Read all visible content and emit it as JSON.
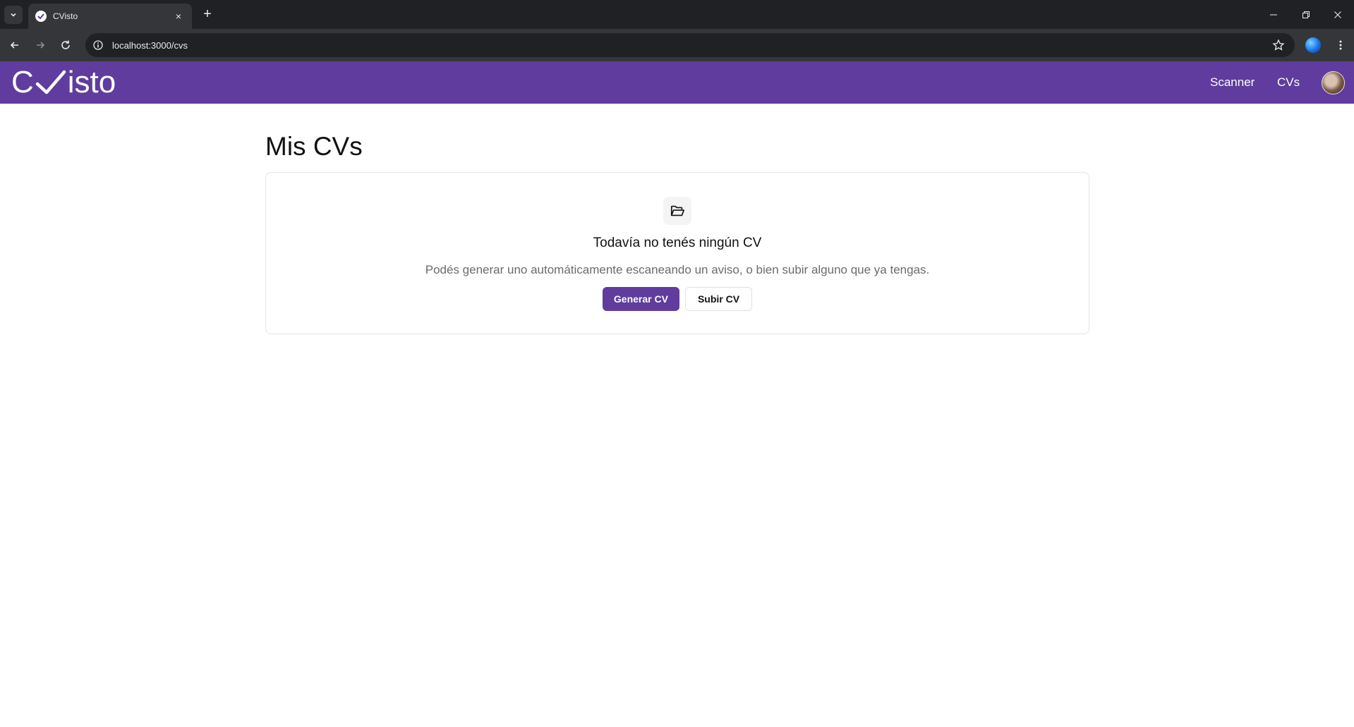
{
  "browser": {
    "tab_title": "CVisto",
    "url": "localhost:3000/cvs",
    "new_tab_symbol": "+",
    "close_tab_symbol": "×"
  },
  "header": {
    "logo_left": "C",
    "logo_right": "isto",
    "nav": {
      "scanner": "Scanner",
      "cvs": "CVs"
    }
  },
  "main": {
    "title": "Mis CVs",
    "empty_state": {
      "icon": "folder-open-icon",
      "title": "Todavía no tenés ningún CV",
      "description": "Podés generar uno automáticamente escaneando un aviso, o bien subir alguno que ya tengas.",
      "primary_button": "Generar CV",
      "secondary_button": "Subir CV"
    }
  },
  "colors": {
    "brand": "#5f3c9d",
    "chrome_dark": "#202124",
    "chrome_toolbar": "#35363a"
  }
}
